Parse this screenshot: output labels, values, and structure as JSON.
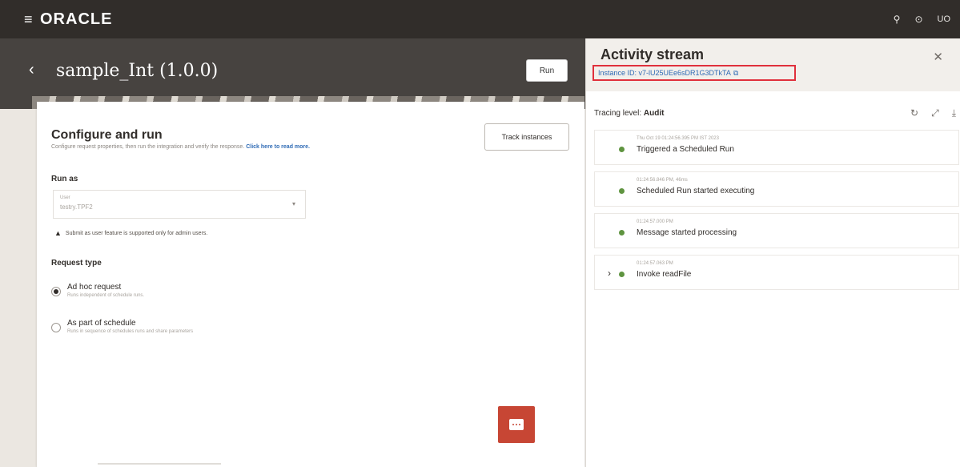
{
  "topbar": {
    "menu_icon": "hamburger-icon",
    "logo": "ORACLE",
    "notifications_icon": "bell-icon",
    "help_icon": "help-circle-icon",
    "avatar": "UO"
  },
  "header": {
    "back_icon": "chevron-left-icon",
    "title": "sample_Int (1.0.0)",
    "run_label": "Run"
  },
  "configure": {
    "title": "Configure and run",
    "description": "Configure request properties, then run the integration and verify the response.",
    "read_more": "Click here to read more.",
    "track_label": "Track instances",
    "run_as_label": "Run as",
    "user_field_label": "User",
    "user_field_value": "testry.TPF2",
    "warning": "Submit as user feature is supported only for admin users.",
    "request_type_label": "Request type",
    "options": [
      {
        "label": "Ad hoc request",
        "sub": "Runs independent of schedule runs.",
        "selected": true
      },
      {
        "label": "As part of schedule",
        "sub": "Runs in sequence of schedules runs and share parameters",
        "selected": false
      }
    ],
    "chat_icon": "chat-bubble-icon"
  },
  "activity_stream": {
    "title": "Activity stream",
    "instance_id": "Instance ID: v7-lU25UEe6sDR1G3DTkTA",
    "copy_icon": "copy-icon",
    "tracing_label": "Tracing level:",
    "tracing_value": "Audit",
    "refresh_icon": "refresh-icon",
    "expand_icon": "expand-icon",
    "download_icon": "download-icon",
    "items": [
      {
        "time": "Thu Oct 19 01:24:56.395 PM IST 2023",
        "label": "Triggered a Scheduled Run",
        "expandable": false
      },
      {
        "time": "01:24:56.846 PM, 46ms",
        "label": "Scheduled Run started executing",
        "expandable": false
      },
      {
        "time": "01:24:57.000 PM",
        "label": "Message started processing",
        "expandable": false
      },
      {
        "time": "01:24:57.063 PM",
        "label": "Invoke readFile",
        "expandable": true
      }
    ],
    "status_color": "#5f9440"
  }
}
